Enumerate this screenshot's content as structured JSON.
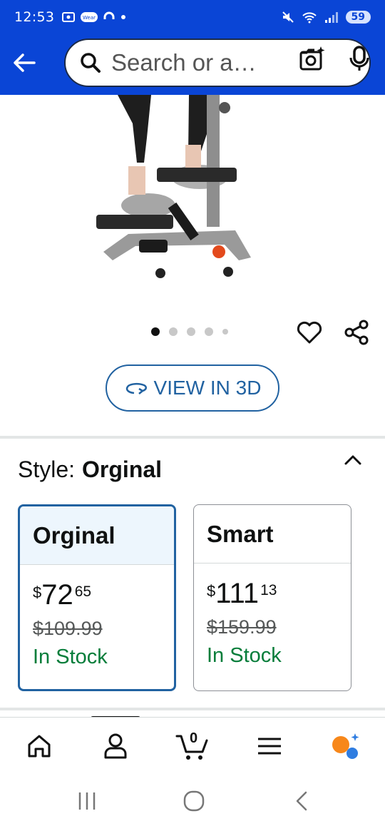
{
  "status_bar": {
    "time": "12:53",
    "left_icons": [
      "screenshot-icon",
      "wear-icon",
      "headset-icon",
      "notification-dot-icon"
    ],
    "right_icons": [
      "mute-icon",
      "wifi-icon",
      "signal-icon"
    ],
    "battery": "59"
  },
  "search": {
    "placeholder": "Search or a…",
    "back_icon": "arrow-left-icon",
    "camera_icon": "camera-lens-icon",
    "mic_icon": "microphone-icon"
  },
  "gallery": {
    "image_count": 5,
    "active_index": 0,
    "view3d_label": "VIEW IN 3D"
  },
  "style": {
    "label": "Style:",
    "selected_value": "Orginal"
  },
  "options": [
    {
      "name": "Orginal",
      "currency": "$",
      "price_whole": "72",
      "price_fraction": "65",
      "list_price": "$109.99",
      "stock": "In Stock",
      "selected": true
    },
    {
      "name": "Smart",
      "currency": "$",
      "price_whole": "111",
      "price_fraction": "13",
      "list_price": "$159.99",
      "stock": "In Stock",
      "selected": false
    }
  ],
  "bottom_nav": {
    "items": [
      "home-icon",
      "account-icon",
      "cart-icon",
      "menu-icon",
      "rufus-icon"
    ],
    "cart_count": "0"
  },
  "colors": {
    "header_blue": "#0a45d6",
    "link_blue": "#2162a1",
    "stock_green": "#067d3a",
    "rufus_orange": "#f7871a"
  }
}
